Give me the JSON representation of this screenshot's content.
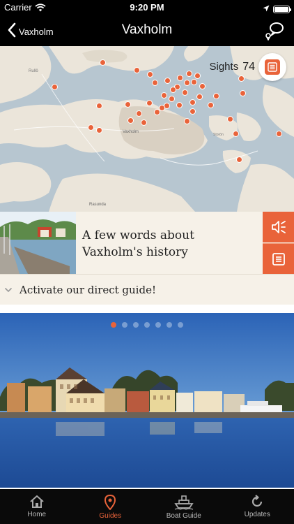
{
  "status_bar": {
    "carrier": "Carrier",
    "time": "9:20 PM"
  },
  "nav": {
    "back_label": "Vaxholm",
    "title": "Vaxholm",
    "icons": [
      "back-chevron-icon",
      "chat-location-icon"
    ]
  },
  "map": {
    "sights_label": "Sights",
    "sights_count": "74",
    "place_labels": [
      "Rullö",
      "Vaxholm",
      "Storön",
      "Rasunda"
    ],
    "colors": {
      "water": "#b7c6d0",
      "land": "#ebe5da",
      "pin": "#e9633a"
    }
  },
  "history": {
    "title_line1": "A few words about",
    "title_line2": "Vaxholm's history"
  },
  "guide": {
    "label": "Activate our direct guide!"
  },
  "carousel": {
    "page_count": 7,
    "active_index": 0
  },
  "tabs": [
    {
      "label": "Home",
      "icon": "home-icon"
    },
    {
      "label": "Guides",
      "icon": "location-pin-icon",
      "active": true
    },
    {
      "label": "Boat Guide",
      "icon": "ship-icon"
    },
    {
      "label": "Updates",
      "icon": "refresh-icon"
    }
  ],
  "colors": {
    "accent": "#e9633a",
    "cream": "#f6f1e8"
  }
}
